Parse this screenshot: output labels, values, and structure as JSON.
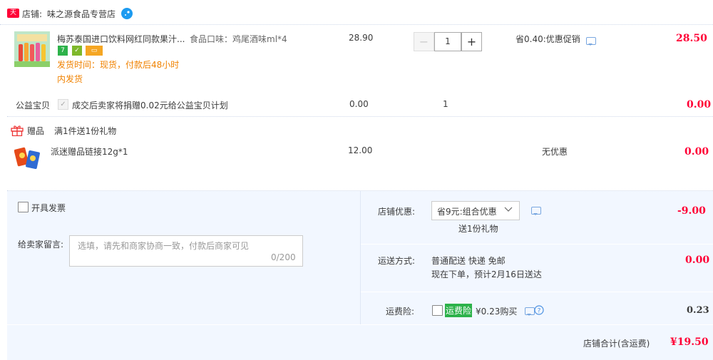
{
  "shop": {
    "label": "店铺:",
    "name": "味之源食品专营店",
    "badge": "天猫"
  },
  "item": {
    "title": "梅苏泰国进口饮料网红同款果汁...",
    "sku": "食品口味：鸡尾酒味ml*4",
    "delivery": [
      "发货时间：现货，付款后48小时",
      "内发货"
    ],
    "price": "28.90",
    "qty": "1",
    "minus": "−",
    "plus": "+",
    "promo": "省0.40:优惠促销",
    "total": "28.50"
  },
  "charity": {
    "label": "公益宝贝",
    "text": "成交后卖家将捐赠0.02元给公益宝贝计划",
    "price": "0.00",
    "qty": "1",
    "total": "0.00"
  },
  "gift": {
    "label": "赠品",
    "rule": "满1件送1份礼物",
    "name": "派迷赠品链接12g*1",
    "price": "12.00",
    "promo": "无优惠",
    "total": "0.00"
  },
  "invoice": {
    "label": "开具发票"
  },
  "message": {
    "label": "给卖家留言:",
    "placeholder": "选填，请先和商家协商一致，付款后商家可见",
    "counter": "0/200"
  },
  "discount": {
    "label": "店铺优惠:",
    "selected": "省9元:组合优惠",
    "sub": "送1份礼物",
    "amount": "-9.00"
  },
  "shipping": {
    "label": "运送方式:",
    "line1": "普通配送 快递 免邮",
    "line2": "现在下单，预计2月16日送达",
    "amount": "0.00"
  },
  "insurance": {
    "label": "运费险:",
    "tag": "运费险",
    "text": "¥0.23购买",
    "amount": "0.23"
  },
  "footer": {
    "label": "店铺合计(含运费)",
    "amount": "¥19.50"
  },
  "colors": {
    "accent": "#ff0036",
    "panel": "#f2f7ff",
    "orange": "#f08200",
    "tag_green": "#2db24a"
  }
}
